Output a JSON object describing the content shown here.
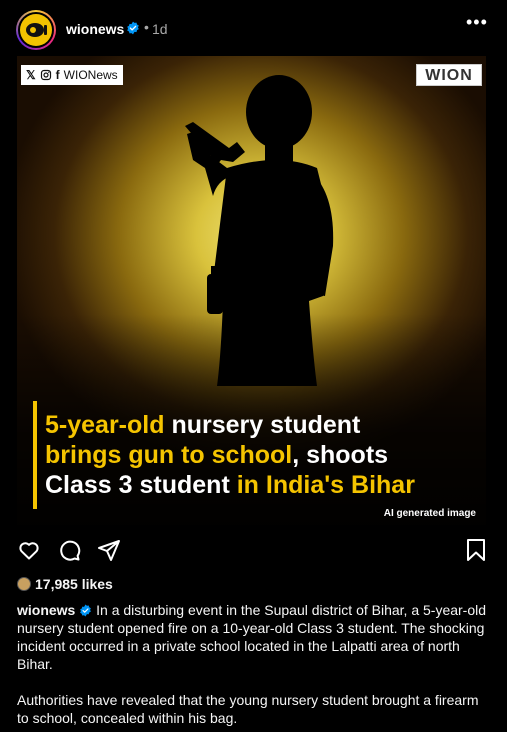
{
  "post": {
    "username": "wionews",
    "separator": "•",
    "time": "1d",
    "more_label": "•••",
    "image": {
      "social_handle": "WIONews",
      "logo_text": "WION",
      "headline_parts": [
        {
          "text": "5-year-old ",
          "highlight": true
        },
        {
          "text": "nursery student ",
          "highlight": false
        },
        {
          "text": "brings gun to school",
          "highlight": true
        },
        {
          "text": ", shoots ",
          "highlight": false
        },
        {
          "text": "Class 3 student ",
          "highlight": false
        },
        {
          "text": "in India's Bihar",
          "highlight": true
        }
      ],
      "ai_label": "AI generated image"
    },
    "likes": "17,985 likes",
    "caption": {
      "username": "wionews",
      "paragraph1": "In a disturbing event in the Supaul district of Bihar, a 5-year-old nursery student opened fire on a 10-year-old Class 3 student. The shocking incident occurred in a private school located in the Lalpatti area of north Bihar.",
      "paragraph2": "Authorities have revealed that the young nursery student brought a firearm to school, concealed within his bag."
    }
  },
  "colors": {
    "background": "#000000",
    "highlight": "#f5c400",
    "verified": "#0095f6",
    "muted": "#a8a8a8"
  },
  "icons": [
    "heart-icon",
    "comment-icon",
    "share-icon",
    "bookmark-icon",
    "verified-icon",
    "x-icon",
    "instagram-icon",
    "facebook-icon"
  ]
}
